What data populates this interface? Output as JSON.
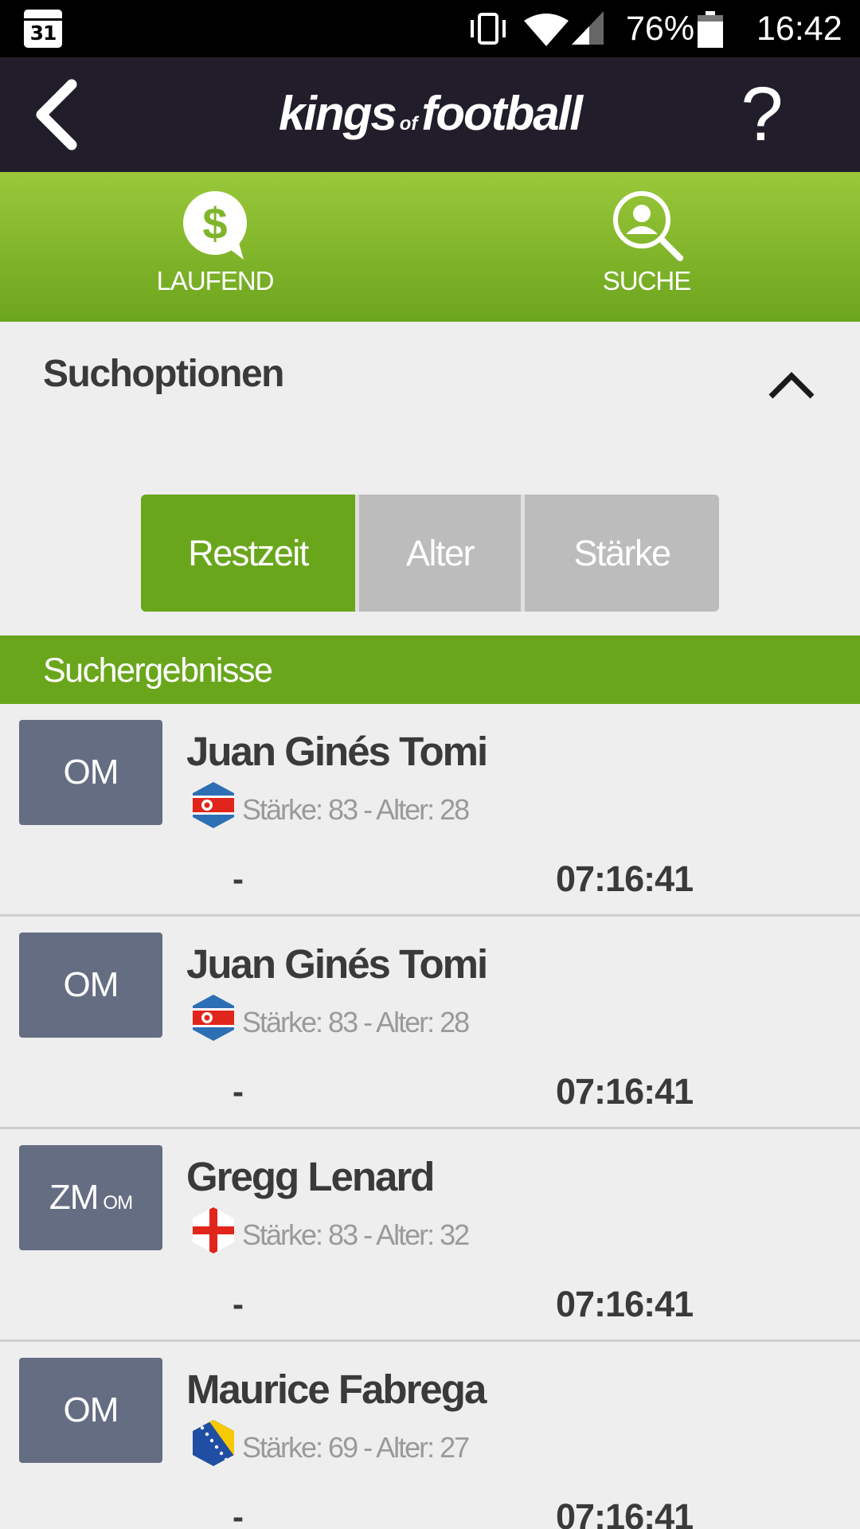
{
  "status_bar": {
    "calendar_day": "31",
    "battery_percent": "76%",
    "time": "16:42",
    "icons": [
      "calendar-icon",
      "vibrate-icon",
      "wifi-icon",
      "cell-signal-icon",
      "battery-icon"
    ]
  },
  "header": {
    "logo_part1": "kings",
    "logo_part2": "of",
    "logo_part3": "football",
    "help_label": "?"
  },
  "tabs": [
    {
      "label": "LAUFEND",
      "icon": "dollar-speech-icon"
    },
    {
      "label": "SUCHE",
      "icon": "user-search-icon"
    }
  ],
  "search_options": {
    "title": "Suchoptionen",
    "sort_options": [
      "Restzeit",
      "Alter",
      "Stärke"
    ],
    "selected": "Restzeit"
  },
  "results": {
    "title": "Suchergebnisse",
    "players": [
      {
        "position": "OM",
        "position_sub": "",
        "name": "Juan Ginés Tomi",
        "flag": "north-korea-flag",
        "stats": "Stärke: 83 - Alter: 28",
        "bid": "-",
        "time": "07:16:41"
      },
      {
        "position": "OM",
        "position_sub": "",
        "name": "Juan Ginés Tomi",
        "flag": "north-korea-flag",
        "stats": "Stärke: 83 - Alter: 28",
        "bid": "-",
        "time": "07:16:41"
      },
      {
        "position": "ZM",
        "position_sub": "OM",
        "name": "Gregg Lenard",
        "flag": "england-flag",
        "stats": "Stärke: 83 - Alter: 32",
        "bid": "-",
        "time": "07:16:41"
      },
      {
        "position": "OM",
        "position_sub": "",
        "name": "Maurice Fabrega",
        "flag": "bosnia-flag",
        "stats": "Stärke: 69 - Alter: 27",
        "bid": "-",
        "time": "07:16:41"
      }
    ]
  },
  "colors": {
    "header_bg": "#221d2b",
    "accent_green": "#6aa61c",
    "position_badge": "#656d83",
    "inactive_segment": "#bcbcbc"
  }
}
